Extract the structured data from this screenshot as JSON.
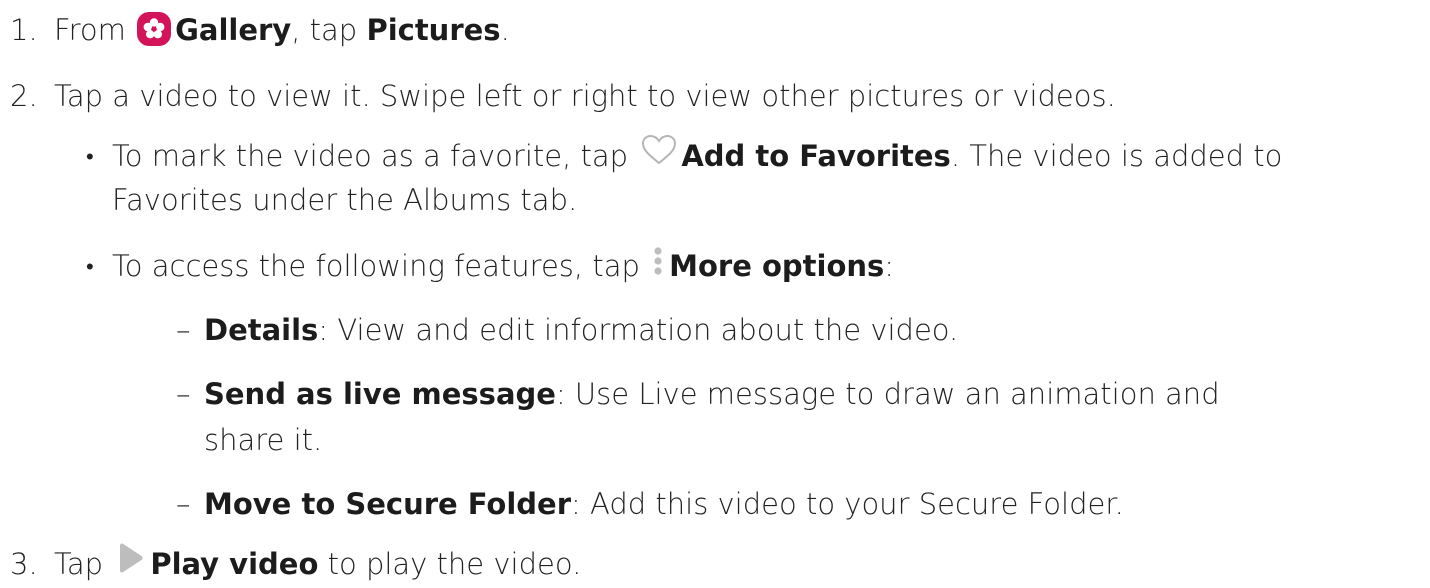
{
  "steps": {
    "s1": {
      "num": "1.",
      "t1": "From ",
      "gallery": "Gallery",
      "t2": ", tap ",
      "pictures": "Pictures",
      "t3": "."
    },
    "s2": {
      "num": "2.",
      "text": "Tap a video to view it. Swipe left or right to view other pictures or videos."
    },
    "b1": {
      "bullet": "•",
      "t1": "To mark the video as a favorite, tap ",
      "add_fav": "Add to Favorites",
      "t2": ". The video is added to",
      "line2": "Favorites under the Albums tab."
    },
    "b2": {
      "bullet": "•",
      "t1": "To access the following features, tap ",
      "more": "More options",
      "t2": ":"
    },
    "d1": {
      "dash": "–",
      "label": "Details",
      "text": ": View and edit information about the video."
    },
    "d2": {
      "dash": "–",
      "label": "Send as live message",
      "text": ": Use Live message to draw an animation and",
      "line2": "share it."
    },
    "d3": {
      "dash": "–",
      "label": "Move to Secure Folder",
      "text": ": Add this video to your Secure Folder."
    },
    "s3": {
      "num": "3.",
      "t1": "Tap ",
      "play": "Play video",
      "t2": " to play the video."
    }
  },
  "icons": {
    "gallery": "gallery-app-icon",
    "heart": "heart-outline-icon",
    "more": "more-options-icon",
    "play": "play-icon"
  },
  "colors": {
    "text": "#222222",
    "gallery_icon_bg": "#d4145a",
    "icon_gray": "#bdbdbd"
  }
}
